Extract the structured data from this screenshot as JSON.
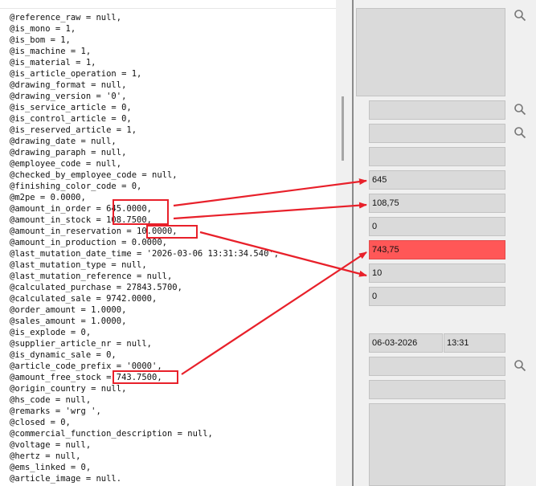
{
  "code_lines": [
    "@reference_raw = null,",
    "@is_mono = 1,",
    "@is_bom = 1,",
    "@is_machine = 1,",
    "@is_material = 1,",
    "@is_article_operation = 1,",
    "@drawing_format = null,",
    "@drawing_version = '0',",
    "@is_service_article = 0,",
    "@is_control_article = 0,",
    "@is_reserved_article = 1,",
    "@drawing_date = null,",
    "@drawing_paraph = null,",
    "@employee_code = null,",
    "@checked_by_employee_code = null,",
    "@finishing_color_code = 0,",
    "@m2pe = 0.0000,",
    "@amount_in_order = 645.0000,",
    "@amount_in_stock = 108.7500,",
    "@amount_in_reservation = 10.0000,",
    "@amount_in_production = 0.0000,",
    "@last_mutation_date_time = '2026-03-06 13:31:34.540',",
    "@last_mutation_type = null,",
    "@last_mutation_reference = null,",
    "@calculated_purchase = 27843.5700,",
    "@calculated_sale = 9742.0000,",
    "@order_amount = 1.0000,",
    "@sales_amount = 1.0000,",
    "@is_explode = 0,",
    "@supplier_article_nr = null,",
    "@is_dynamic_sale = 0,",
    "@article_code_prefix = '0000',",
    "@amount_free_stock = 743.7500,",
    "@origin_country = null,",
    "@hs_code = null,",
    "@remarks = 'wrg ',",
    "@closed = 0,",
    "@commercial_function_description = null,",
    "@voltage = null,",
    "@hertz = null,",
    "@ems_linked = 0,",
    "@article_image = null."
  ],
  "fields": {
    "amount_in_order": "645",
    "amount_in_stock": "108,75",
    "field_zero_1": "0",
    "amount_free_stock": "743,75",
    "amount_in_reservation": "10",
    "field_zero_2": "0",
    "mutation_date": "06-03-2026",
    "mutation_time": "13:31"
  },
  "colors": {
    "annotation_red": "#e8202a",
    "highlight_field": "#ff5757",
    "field_bg": "#dadada",
    "panel_bg": "#f0f0f0"
  },
  "icons": [
    "search-icon"
  ]
}
